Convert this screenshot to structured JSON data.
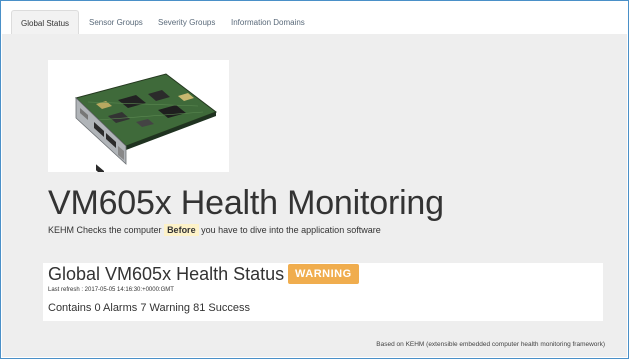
{
  "tabs": [
    {
      "label": "Global Status",
      "active": true
    },
    {
      "label": "Sensor Groups",
      "active": false
    },
    {
      "label": "Severity Groups",
      "active": false
    },
    {
      "label": "Information Domains",
      "active": false
    }
  ],
  "header": {
    "title": "VM605x Health Monitoring",
    "subtitle_before": "KEHM Checks the computer",
    "subtitle_highlight": "Before",
    "subtitle_after": "you have to dive into the application software"
  },
  "status": {
    "title": "Global VM605x Health Status is:",
    "badge": "WARNING",
    "last_refresh": "Last refresh : 2017-05-05 14:16:30:+0000:GMT",
    "counts": "Contains 0 Alarms 7 Warning 81 Success"
  },
  "footer": {
    "text": "Based on KEHM (extensible embedded computer health monitoring framework)"
  },
  "colors": {
    "accent_border": "#4a90c8",
    "warning": "#f0ad4e",
    "panel_bg": "#eeeeee",
    "highlight": "#fdf2c8"
  }
}
